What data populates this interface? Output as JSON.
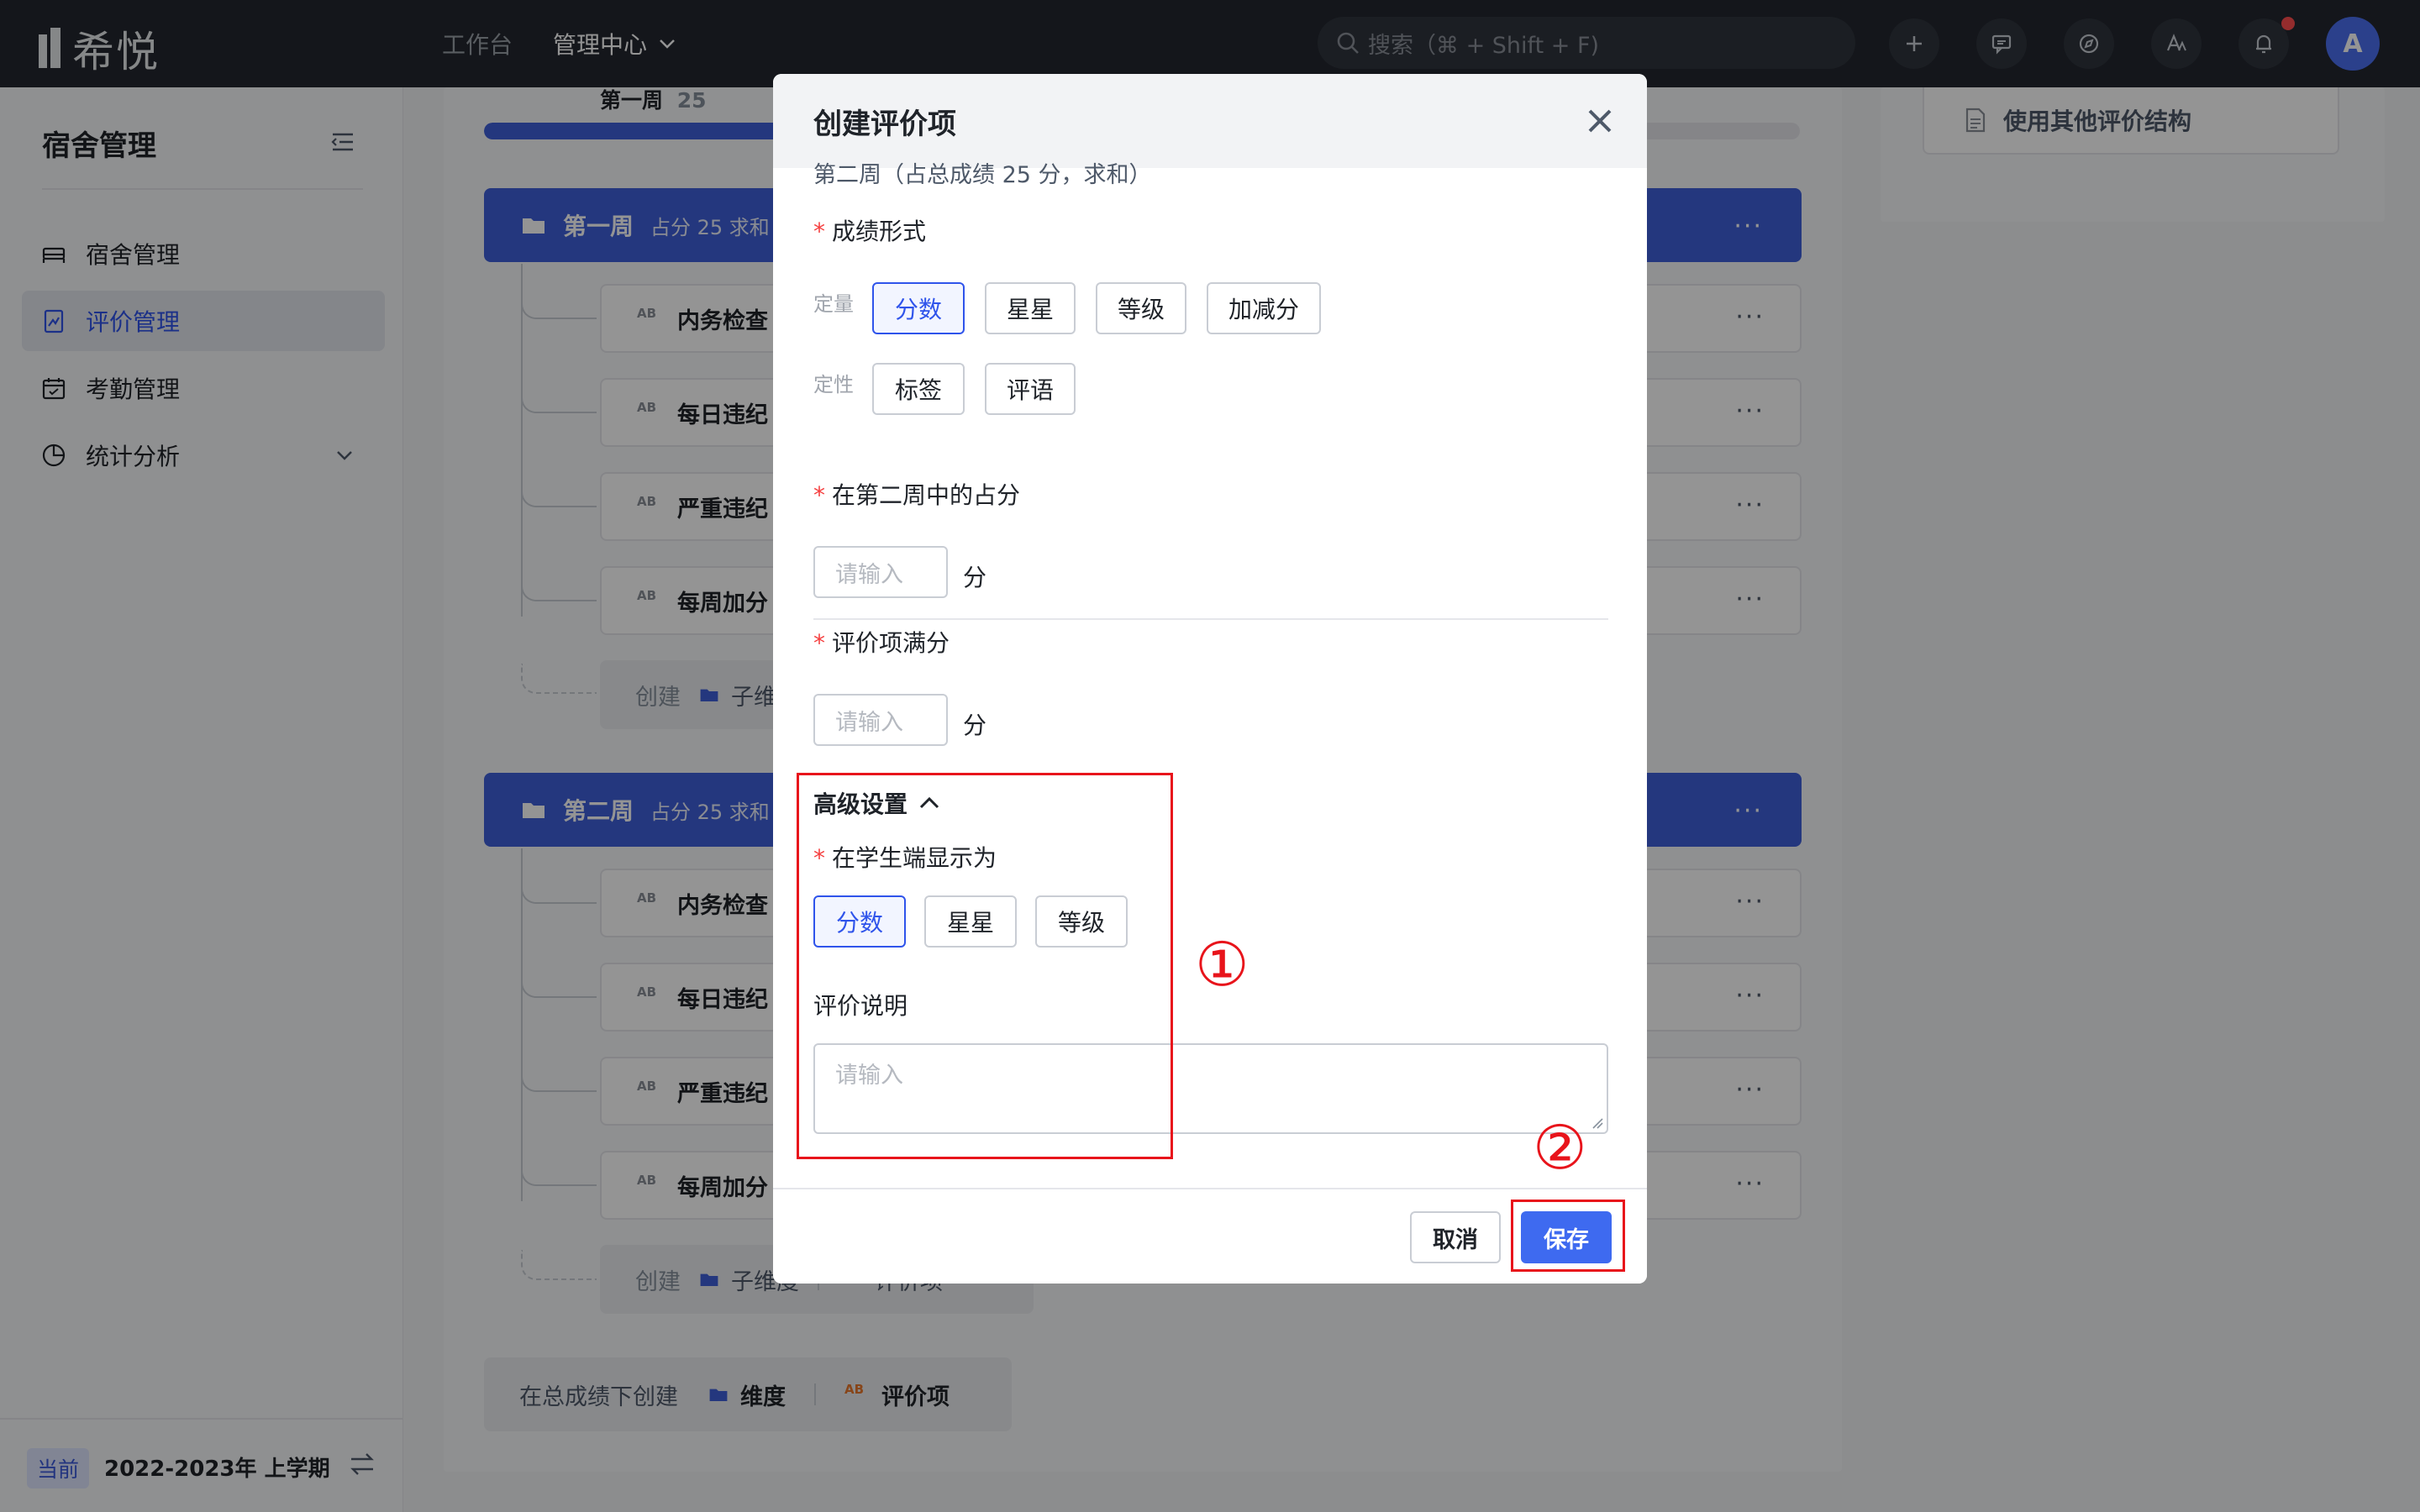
{
  "topbar": {
    "logo_text": "希悦",
    "nav": [
      "工作台",
      "管理中心"
    ],
    "search_placeholder": "搜索（⌘ + Shift + F)",
    "avatar_letter": "A"
  },
  "sidebar": {
    "title": "宿舍管理",
    "items": [
      {
        "label": "宿舍管理",
        "icon": "bed-icon"
      },
      {
        "label": "评价管理",
        "icon": "evaluation-icon"
      },
      {
        "label": "考勤管理",
        "icon": "calendar-icon"
      },
      {
        "label": "统计分析",
        "icon": "pie-chart-icon"
      }
    ],
    "term_tag": "当前",
    "term_label": "2022-2023年 上学期"
  },
  "main": {
    "progress_label": "第一周",
    "progress_value": "25",
    "progress_fraction": 0.45,
    "weeks": [
      {
        "title": "第一周",
        "sub": "占分 25 求和",
        "items": [
          "内务检查",
          "每日违纪",
          "严重违纪",
          "每周加分"
        ]
      },
      {
        "title": "第二周",
        "sub": "占分 25 求和",
        "items": [
          "内务检查",
          "每日违纪",
          "严重违纪",
          "每周加分"
        ]
      }
    ],
    "create_label": "创建",
    "create_dim": "子维度",
    "create_item": "评价项",
    "total_create": "在总成绩下创建",
    "total_dim": "维度",
    "total_item": "评价项",
    "more": "···",
    "use_other": "使用其他评价结构"
  },
  "modal": {
    "title": "创建评价项",
    "context": "第二周（占总成绩 25 分，求和）",
    "form_label": "成绩形式",
    "quant_label": "定量",
    "quant_options": [
      "分数",
      "星星",
      "等级",
      "加减分"
    ],
    "qual_label": "定性",
    "qual_options": [
      "标签",
      "评语"
    ],
    "share_label": "在第二周中的占分",
    "share_placeholder": "请输入",
    "full_label": "评价项满分",
    "full_placeholder": "请输入",
    "unit": "分",
    "advanced_label": "高级设置",
    "student_display_label": "在学生端显示为",
    "display_options": [
      "分数",
      "星星",
      "等级"
    ],
    "desc_label": "评价说明",
    "desc_placeholder": "请输入",
    "cancel": "取消",
    "save": "保存"
  },
  "annotations": {
    "one": "①",
    "two": "②"
  }
}
